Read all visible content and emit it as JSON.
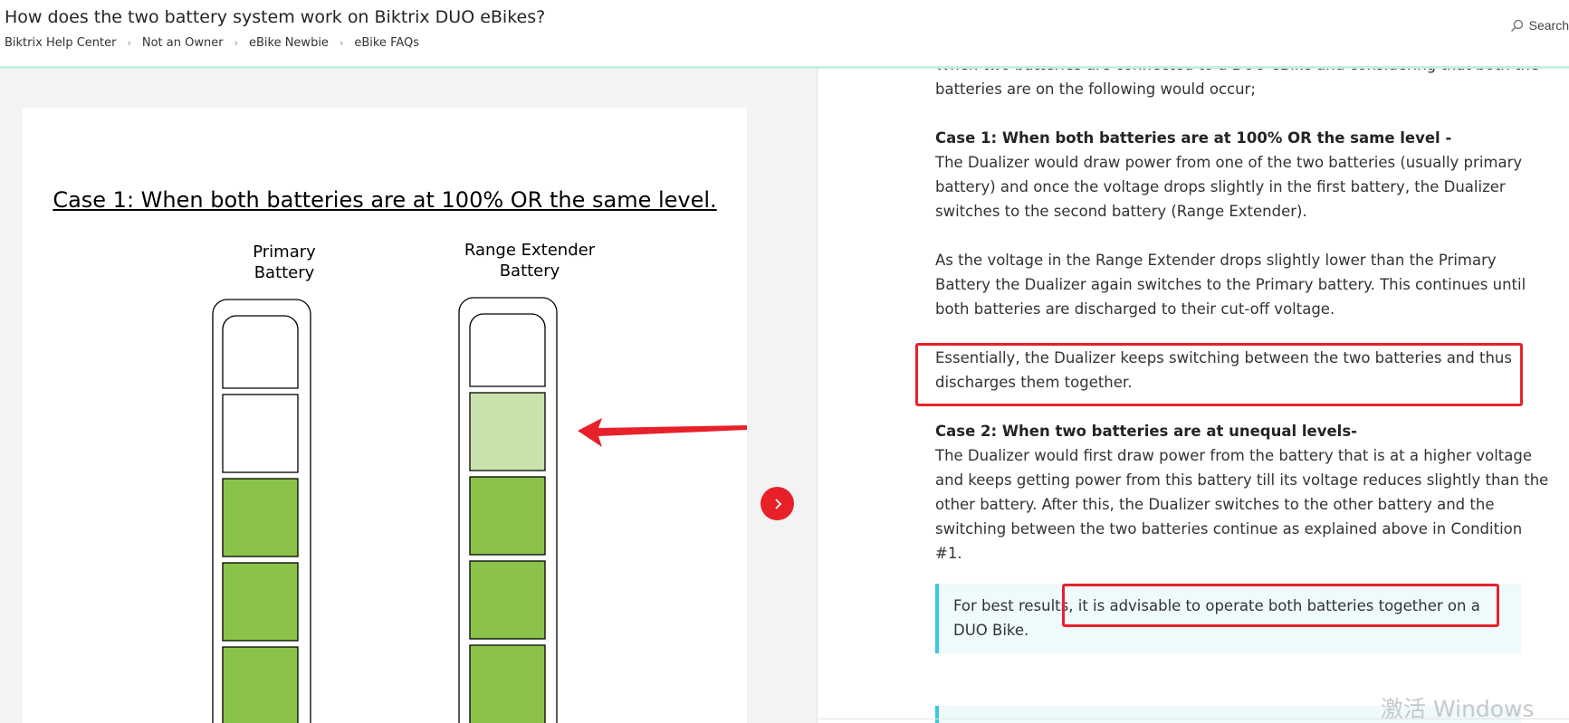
{
  "header": {
    "title": "How does the two battery system work on Biktrix DUO eBikes?",
    "breadcrumb": [
      "Biktrix Help Center",
      "Not an Owner",
      "eBike Newbie",
      "eBike FAQs"
    ],
    "search_label": "Search"
  },
  "diagram": {
    "title": "Case 1: When both batteries are at 100% OR the same level.",
    "primary_label_line1": "Primary",
    "primary_label_line2": "Battery",
    "extender_label_line1": "Range Extender",
    "extender_label_line2": "Battery",
    "primary_levels": [
      "empty",
      "empty",
      "full",
      "full",
      "full"
    ],
    "extender_levels": [
      "empty",
      "partial",
      "full",
      "full",
      "full"
    ],
    "colors": {
      "full": "#8bc34a",
      "partial": "#c9e2ab",
      "empty": "#ffffff",
      "arrow": "#e8202a"
    }
  },
  "article": {
    "intro_partial": "When two batteries are connected to a DUO eBike and considering that both the",
    "intro_rest": "batteries are on the following would occur;",
    "case1_heading": "Case 1: When both batteries are at 100% OR the same level -",
    "case1_p1": "The Dualizer would draw power from one of the two batteries (usually primary battery) and once the voltage drops slightly in the first battery, the Dualizer switches to the second battery (Range Extender).",
    "case1_p2": "As the voltage in the Range Extender drops slightly lower than the Primary Battery the Dualizer again switches to the Primary battery. This continues until both batteries are discharged to their cut-off voltage.",
    "case1_p3": "Essentially, the Dualizer keeps switching between the two batteries and thus discharges them together.",
    "case2_heading": "Case 2: When two batteries are at unequal levels-",
    "case2_p1": "The Dualizer would first draw power from the battery that is at a higher voltage and keeps getting power from this battery till its voltage reduces slightly than the other battery. After this, the Dualizer switches to the other battery and the switching between the two batteries continue as explained above in Condition #1.",
    "callout": "For best results, it is advisable to operate both batteries together on a DUO Bike."
  },
  "watermark": "激活 Windows",
  "accent_color": "#e8202a"
}
